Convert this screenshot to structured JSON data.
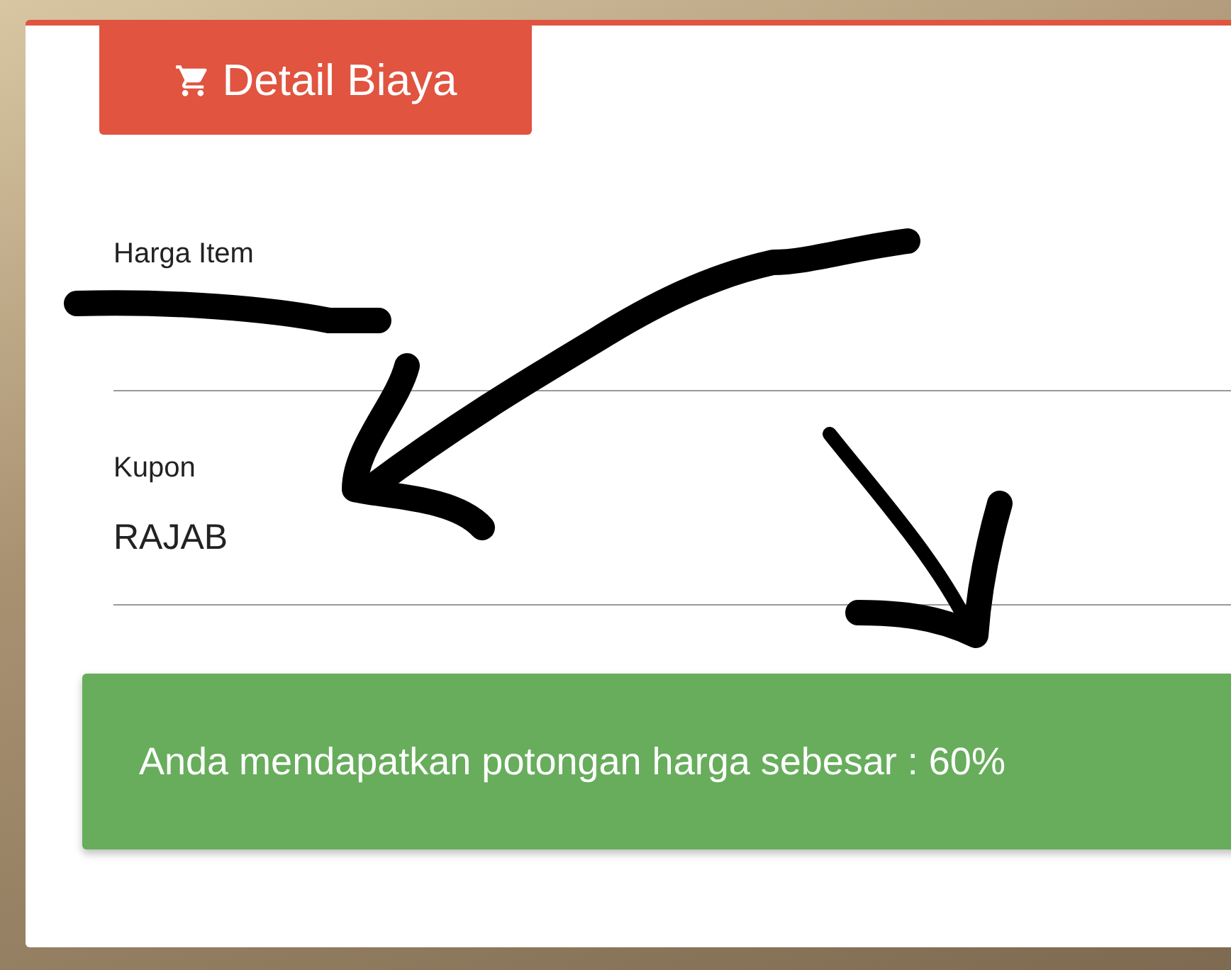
{
  "card": {
    "title": "Detail Biaya",
    "fields": [
      {
        "label": "Harga Item",
        "value_redacted": true
      },
      {
        "label": "Kupon",
        "value": "RAJAB",
        "value_redacted": false
      }
    ],
    "alert": {
      "text": "Anda mendapatkan potongan harga sebesar : 60%"
    }
  }
}
